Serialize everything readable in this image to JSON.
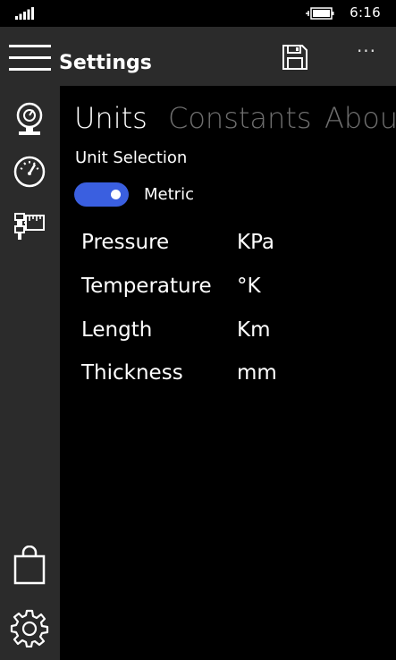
{
  "status_bar": {
    "time": "6:16"
  },
  "app_bar": {
    "title": "Settings",
    "more_label": "···"
  },
  "sidebar": {
    "items": [
      {
        "icon": "pressure-gauge-icon"
      },
      {
        "icon": "speedometer-icon"
      },
      {
        "icon": "pipe-ruler-icon"
      }
    ],
    "bottom": [
      {
        "icon": "shopping-bag-icon"
      },
      {
        "icon": "gear-icon"
      }
    ]
  },
  "pivot": {
    "tabs": [
      {
        "label": "Units",
        "active": true
      },
      {
        "label": "Constants",
        "active": false
      },
      {
        "label": "About",
        "active": false
      }
    ]
  },
  "units": {
    "section_label": "Unit Selection",
    "toggle": {
      "on": true,
      "label": "Metric",
      "color": "#3a5fe0"
    },
    "rows": [
      {
        "label": "Pressure",
        "value": "KPa"
      },
      {
        "label": "Temperature",
        "value": "°K"
      },
      {
        "label": "Length",
        "value": "Km"
      },
      {
        "label": "Thickness",
        "value": "mm"
      }
    ]
  },
  "colors": {
    "sidebar_bg": "#2b2b2b",
    "background": "#000000",
    "accent": "#3a5fe0",
    "inactive_tab": "#6e6e6e"
  }
}
